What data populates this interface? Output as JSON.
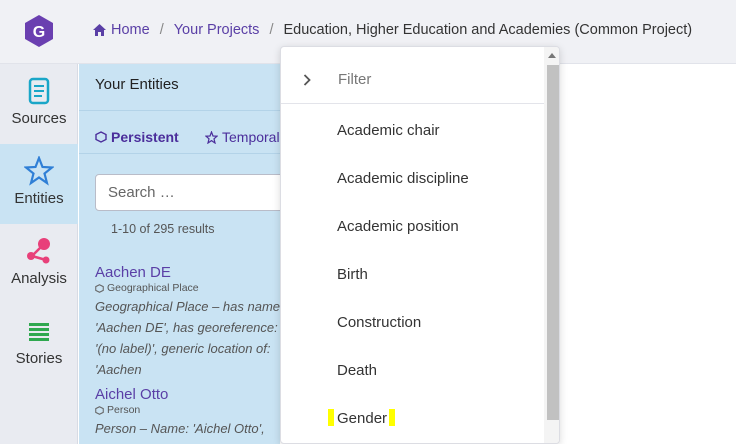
{
  "breadcrumb": {
    "home": "Home",
    "projects": "Your Projects",
    "current": "Education, Higher Education and Academies (Common Project)",
    "separator": "/"
  },
  "nav": {
    "items": [
      {
        "label": "Sources",
        "icon": "scroll-icon"
      },
      {
        "label": "Entities",
        "icon": "star-icon",
        "active": true
      },
      {
        "label": "Analysis",
        "icon": "network-icon"
      },
      {
        "label": "Stories",
        "icon": "lines-icon"
      }
    ]
  },
  "panel": {
    "title": "Your Entities",
    "tabs": [
      {
        "label": "Persistent",
        "icon": "hexagon-icon",
        "active": true
      },
      {
        "label": "Temporal",
        "icon": "star-outline-icon"
      }
    ],
    "search_placeholder": "Search …",
    "results": "1-10 of 295 results",
    "entities": [
      {
        "name": "Aachen DE",
        "type": "Geographical Place",
        "desc": "Geographical Place – has name: 'Aachen DE', has georeference: '(no label)', generic location of: 'Aachen"
      },
      {
        "name": "Aichel Otto",
        "type": "Person",
        "desc": "Person – Name: 'Aichel Otto', has"
      }
    ]
  },
  "dropdown": {
    "filter_placeholder": "Filter",
    "options": [
      "Academic chair",
      "Academic discipline",
      "Academic position",
      "Birth",
      "Construction",
      "Death",
      "Gender"
    ],
    "highlighted_option": "Gender"
  },
  "colors": {
    "accent": "#5a3fa6",
    "active_nav": "#c9e3f3",
    "highlight": "#ffff00",
    "logo": "#6a3fb0"
  }
}
